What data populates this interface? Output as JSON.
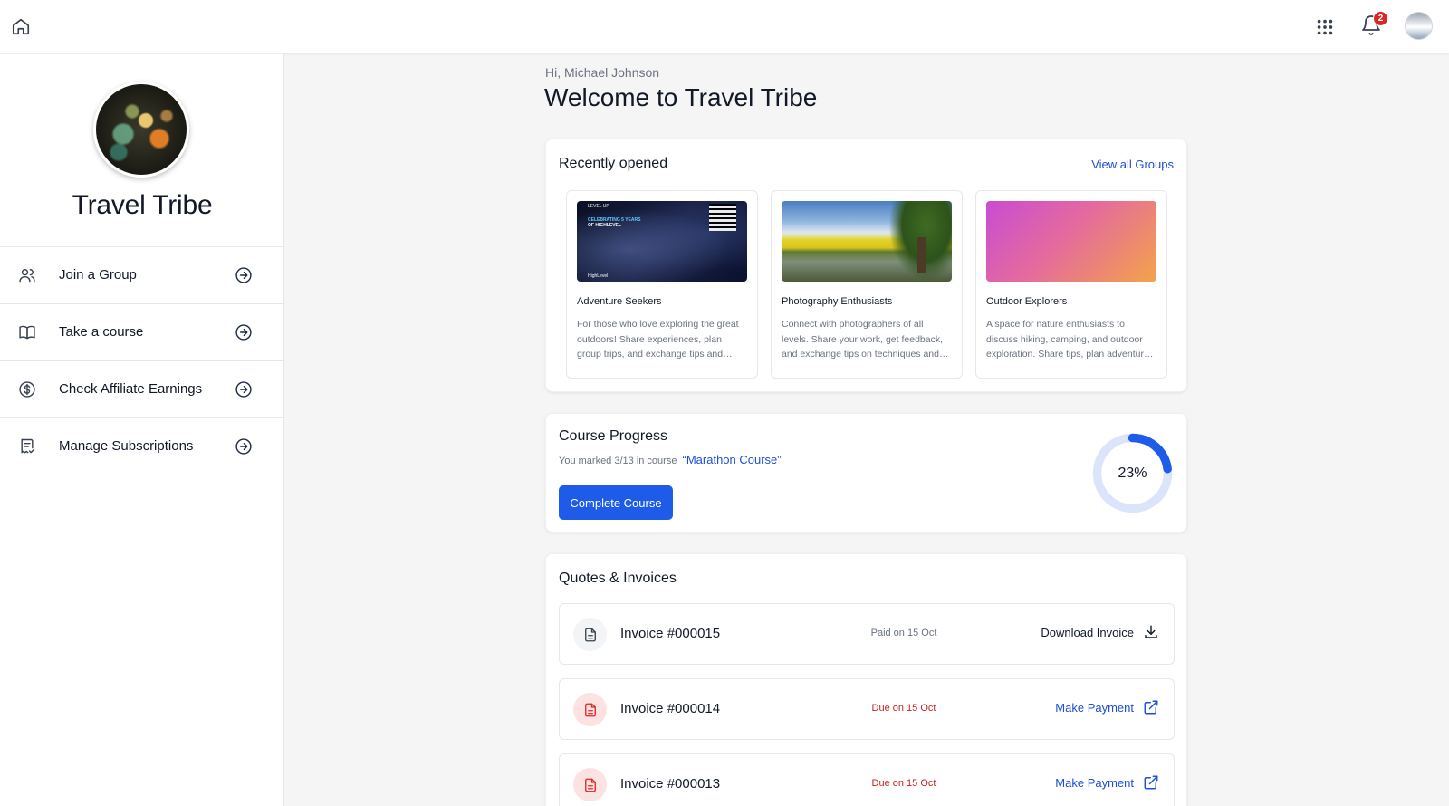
{
  "header": {
    "home_icon": "home-icon",
    "apps_icon": "grid-icon",
    "notification_icon": "bell-icon",
    "notification_count": "2"
  },
  "sidebar": {
    "title": "Travel Tribe",
    "items": [
      {
        "label": "Join a Group",
        "icon": "users-icon"
      },
      {
        "label": "Take a course",
        "icon": "book-icon"
      },
      {
        "label": "Check Affiliate Earnings",
        "icon": "dollar-icon"
      },
      {
        "label": "Manage Subscriptions",
        "icon": "receipt-icon"
      }
    ]
  },
  "main": {
    "greeting": "Hi, Michael Johnson",
    "welcome": "Welcome to Travel Tribe"
  },
  "recent": {
    "title": "Recently opened",
    "view_all": "View all Groups",
    "groups": [
      {
        "name": "Adventure Seekers",
        "description": "For those who love exploring the great outdoors! Share experiences, plan group trips, and exchange tips and stories from every adventure.",
        "image_text_1": "CELEBRATING 5 YEARS",
        "image_text_2": "OF HIGHLEVEL",
        "image_logo": "LEVEL UP",
        "image_brand": "HighLevel"
      },
      {
        "name": "Photography Enthusiasts",
        "description": "Connect with photographers of all levels. Share your work, get feedback, and exchange tips on techniques and gear."
      },
      {
        "name": "Outdoor Explorers",
        "description": "A space for nature enthusiasts to discuss hiking, camping, and outdoor exploration. Share tips, plan adventures together."
      }
    ]
  },
  "progress": {
    "title": "Course Progress",
    "subtitle": "You marked 3/13 in course",
    "course_name": "“Marathon Course”",
    "button": "Complete Course",
    "percent": 23,
    "percent_label": "23%",
    "ring_color": "#1d5be8",
    "track_color": "#dbe4fb"
  },
  "invoices": {
    "title": "Quotes & Invoices",
    "rows": [
      {
        "name": "Invoice #000015",
        "status": "Paid on 15 Oct",
        "action": "Download Invoice"
      },
      {
        "name": "Invoice #000014",
        "status": "Due on 15 Oct",
        "action": "Make Payment"
      },
      {
        "name": "Invoice #000013",
        "status": "Due on 15 Oct",
        "action": "Make Payment"
      }
    ]
  }
}
